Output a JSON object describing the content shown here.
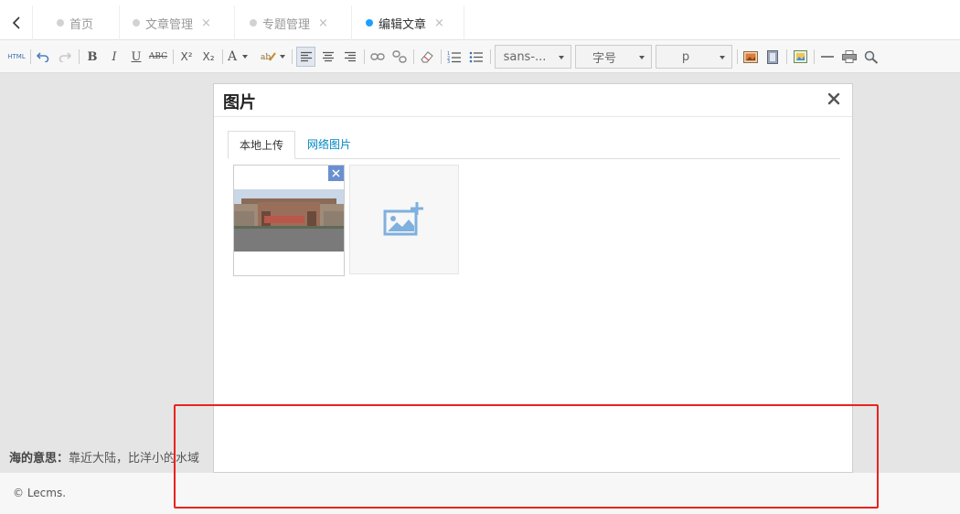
{
  "tabs": [
    {
      "label": "首页",
      "closable": false,
      "active": false
    },
    {
      "label": "文章管理",
      "closable": true,
      "active": false
    },
    {
      "label": "专题管理",
      "closable": true,
      "active": false
    },
    {
      "label": "编辑文章",
      "closable": true,
      "active": true
    }
  ],
  "tab_close_glyph": "×",
  "toolbar": {
    "html_label": "HTML",
    "bold": "B",
    "italic": "I",
    "underline": "U",
    "strike": "ABC",
    "superscript": "X²",
    "subscript": "X₂",
    "font_color": "A",
    "font_family": "sans-...",
    "font_size": "字号",
    "paragraph": "p"
  },
  "dialog": {
    "title": "图片",
    "close_glyph": "×",
    "tabs": {
      "local": "本地上传",
      "network": "网络图片"
    }
  },
  "background": {
    "text_bold": "海的意思：",
    "text": "靠近大陆，比洋小的水域"
  },
  "footer": {
    "copyright": "© Lecms."
  },
  "colors": {
    "accent": "#1e9fff",
    "link": "#0087c4",
    "highlight": "#e8231f"
  }
}
